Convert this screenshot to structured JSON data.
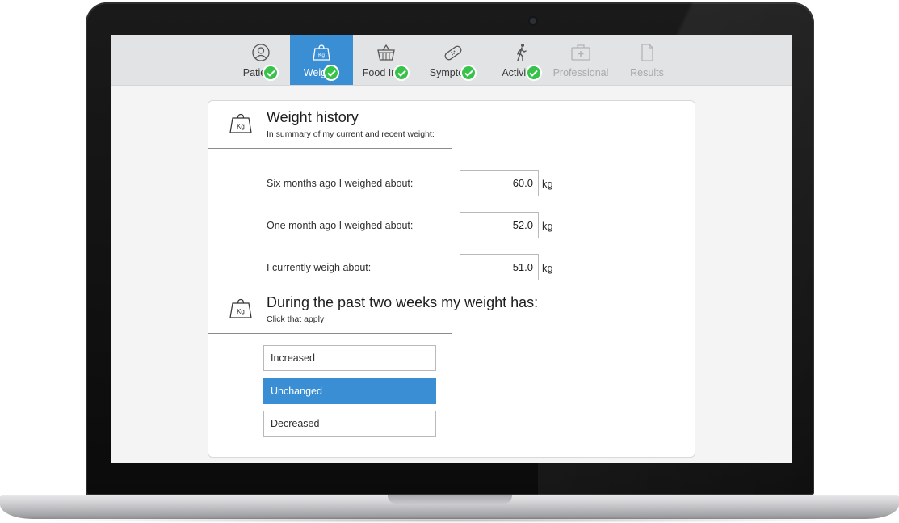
{
  "tabs": [
    {
      "label": "Patie",
      "icon": "user-icon",
      "state": "done"
    },
    {
      "label": "Weig",
      "icon": "weight-icon",
      "state": "active"
    },
    {
      "label": "Food In",
      "icon": "basket-icon",
      "state": "done"
    },
    {
      "label": "Sympto",
      "icon": "bandage-icon",
      "state": "done"
    },
    {
      "label": "Activit",
      "icon": "walking-icon",
      "state": "done"
    },
    {
      "label": "Professional",
      "icon": "medical-kit-icon",
      "state": "disabled"
    },
    {
      "label": "Results",
      "icon": "document-icon",
      "state": "disabled"
    }
  ],
  "weight_history": {
    "title": "Weight history",
    "subtitle": "In summary of my current and recent weight:",
    "icon_text": "Kg",
    "rows": [
      {
        "label": "Six months ago I weighed about:",
        "value": "60.0",
        "unit": "kg"
      },
      {
        "label": "One month ago I weighed about:",
        "value": "52.0",
        "unit": "kg"
      },
      {
        "label": "I currently weigh about:",
        "value": "51.0",
        "unit": "kg"
      }
    ]
  },
  "weight_change": {
    "title": "During the past two weeks my weight has:",
    "subtitle": "Click that apply",
    "icon_text": "Kg",
    "options": [
      {
        "label": "Increased",
        "selected": false
      },
      {
        "label": "Unchanged",
        "selected": true
      },
      {
        "label": "Decreased",
        "selected": false
      }
    ]
  },
  "colors": {
    "accent": "#3a8ed4",
    "check": "#37c24a",
    "tabbar_bg": "#e2e3e5"
  }
}
